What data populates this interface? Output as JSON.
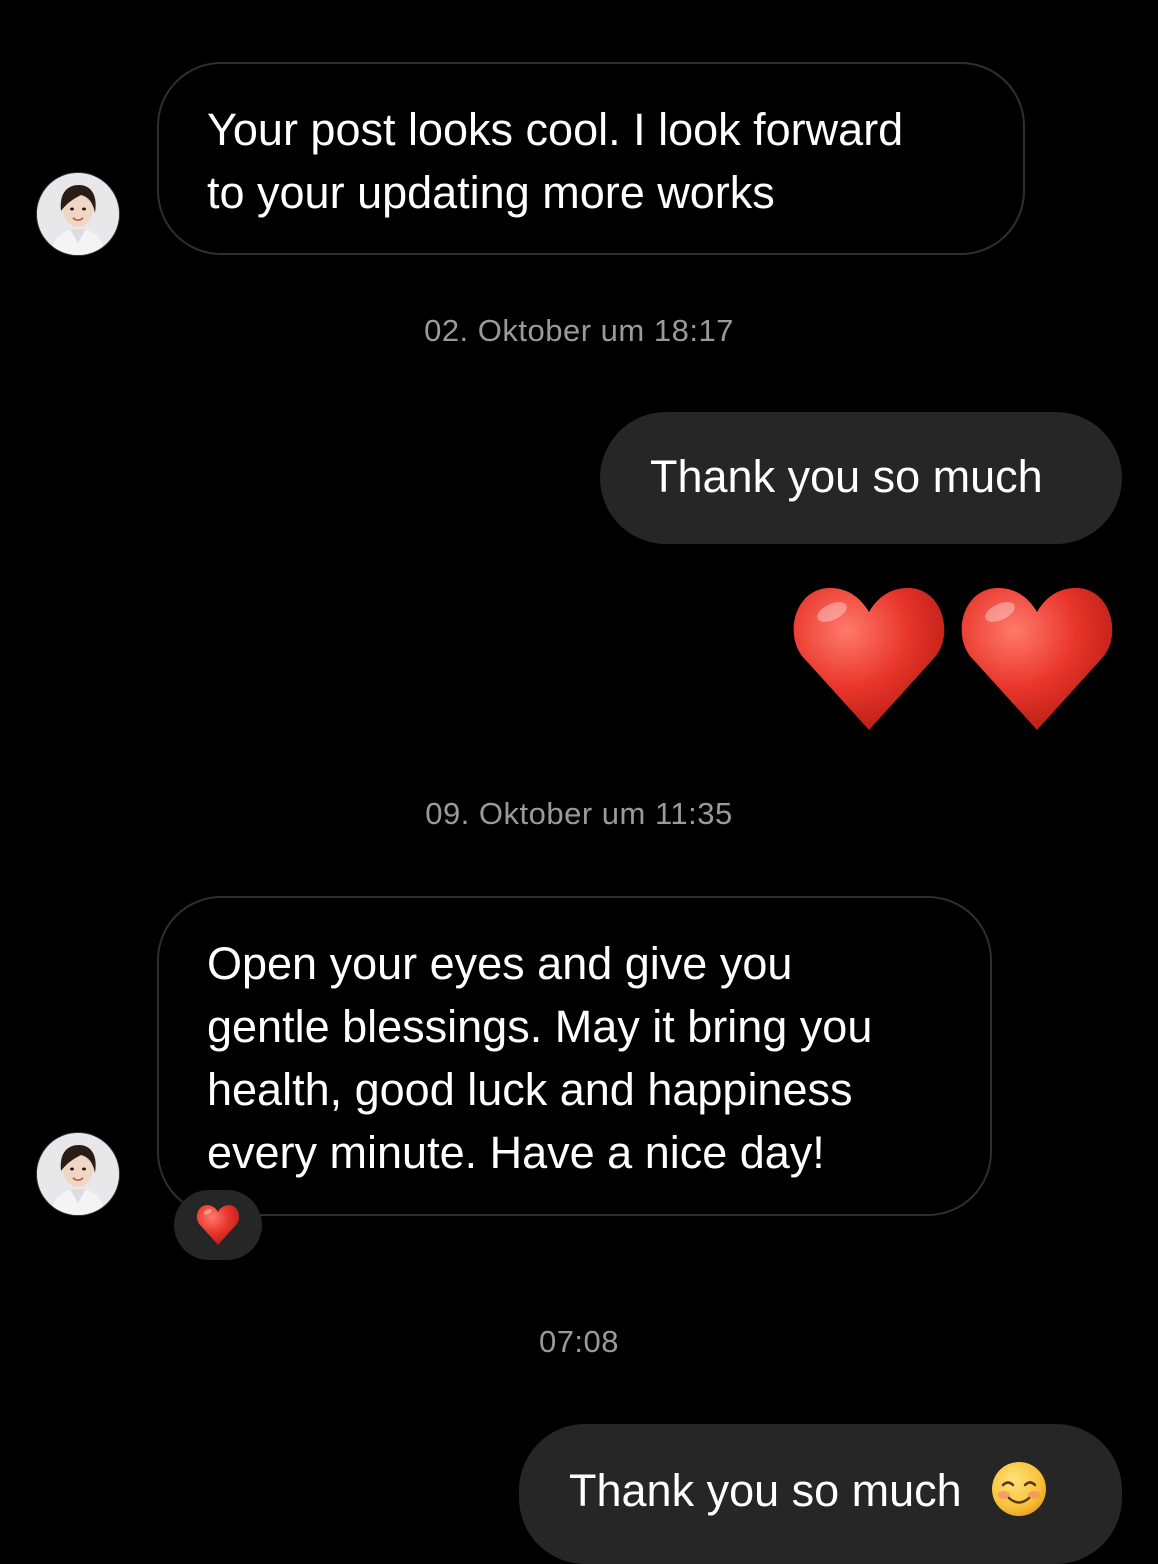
{
  "messages": [
    {
      "sender": "contact",
      "text_lines": [
        "Your post looks cool. I look forward",
        "to your updating more works"
      ]
    },
    {
      "timestamp": "02. Oktober um 18:17"
    },
    {
      "sender": "me",
      "text": "Thank you so much"
    },
    {
      "sender": "me",
      "emoji": "❤️❤️"
    },
    {
      "timestamp": "09. Oktober um 11:35"
    },
    {
      "sender": "contact",
      "text_lines": [
        "Open your eyes and give you",
        "gentle blessings. May it bring you",
        "health, good luck and happiness",
        "every minute. Have a nice day!"
      ],
      "reaction": "heart-emoji"
    },
    {
      "timestamp": "07:08"
    },
    {
      "sender": "me",
      "text": "Thank you so much",
      "emoji": "smiling-face-emoji"
    }
  ],
  "ui": {
    "t1": "02. Oktober um 18:17",
    "t2": "09. Oktober um 11:35",
    "t3": "07:08",
    "m1_l1": "Your post looks cool. I look forward",
    "m1_l2": "to your updating more works",
    "m2": "Thank you so much",
    "m4_l1": "Open your eyes and give you",
    "m4_l2": "gentle blessings. May it bring you",
    "m4_l3": "health, good luck and happiness",
    "m4_l4": "every minute. Have a nice day!",
    "m5": "Thank you so much"
  },
  "colors": {
    "background": "#000000",
    "incoming_border": "#2f2f2f",
    "outgoing_bubble": "#262626",
    "timestamp": "#9a9a9a",
    "heart": "#e8352a"
  }
}
